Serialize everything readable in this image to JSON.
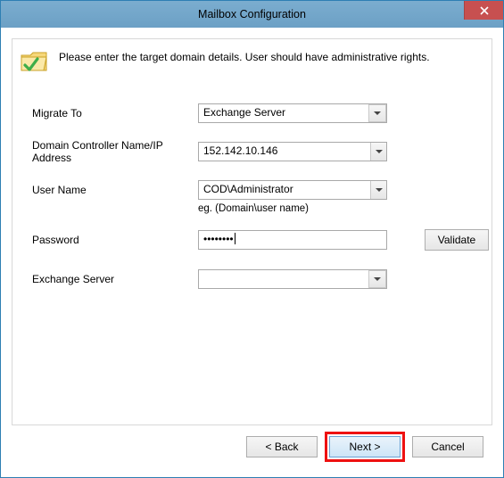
{
  "window": {
    "title": "Mailbox Configuration"
  },
  "info": {
    "message": "Please enter the target domain details. User should have administrative rights."
  },
  "form": {
    "migrate_to_label": "Migrate To",
    "migrate_to_value": "Exchange Server",
    "dc_label": "Domain Controller Name/IP Address",
    "dc_value": "152.142.10.146",
    "username_label": "User Name",
    "username_value": "COD\\Administrator",
    "username_hint": "eg. (Domain\\user name)",
    "password_label": "Password",
    "password_value": "••••••••",
    "validate_label": "Validate",
    "exchange_label": "Exchange Server",
    "exchange_value": ""
  },
  "buttons": {
    "back": "< Back",
    "next": "Next >",
    "cancel": "Cancel"
  }
}
